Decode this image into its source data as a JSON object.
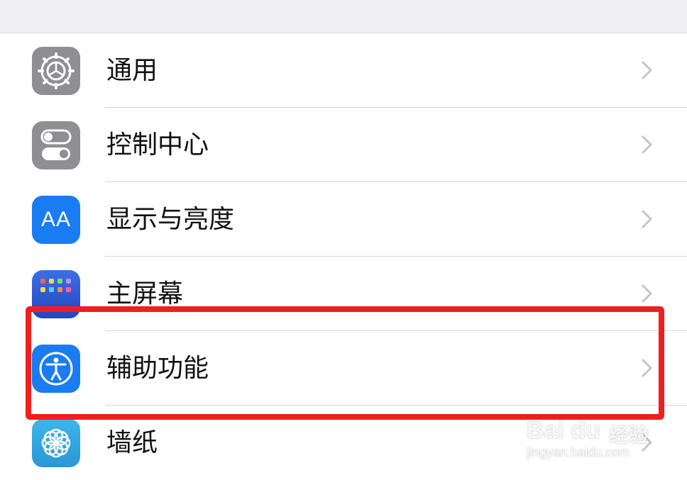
{
  "settings": {
    "items": [
      {
        "label": "通用",
        "icon": "gear-icon",
        "color": "#8e8e93"
      },
      {
        "label": "控制中心",
        "icon": "toggles-icon",
        "color": "#8e8e93"
      },
      {
        "label": "显示与亮度",
        "icon": "text-size-icon",
        "icon_text": "AA",
        "color": "#1a7cf2"
      },
      {
        "label": "主屏幕",
        "icon": "home-grid-icon",
        "color": "#2f5bd8"
      },
      {
        "label": "辅助功能",
        "icon": "accessibility-icon",
        "color": "#1a7cf2"
      },
      {
        "label": "墙纸",
        "icon": "flower-icon",
        "color": "#35a8e0"
      }
    ],
    "highlighted_item": "辅助功能",
    "highlight_color": "#f01e1e"
  },
  "watermark": {
    "brand": "Bai du",
    "brand_cn": "经验",
    "url": "jingyan.baidu.com"
  }
}
